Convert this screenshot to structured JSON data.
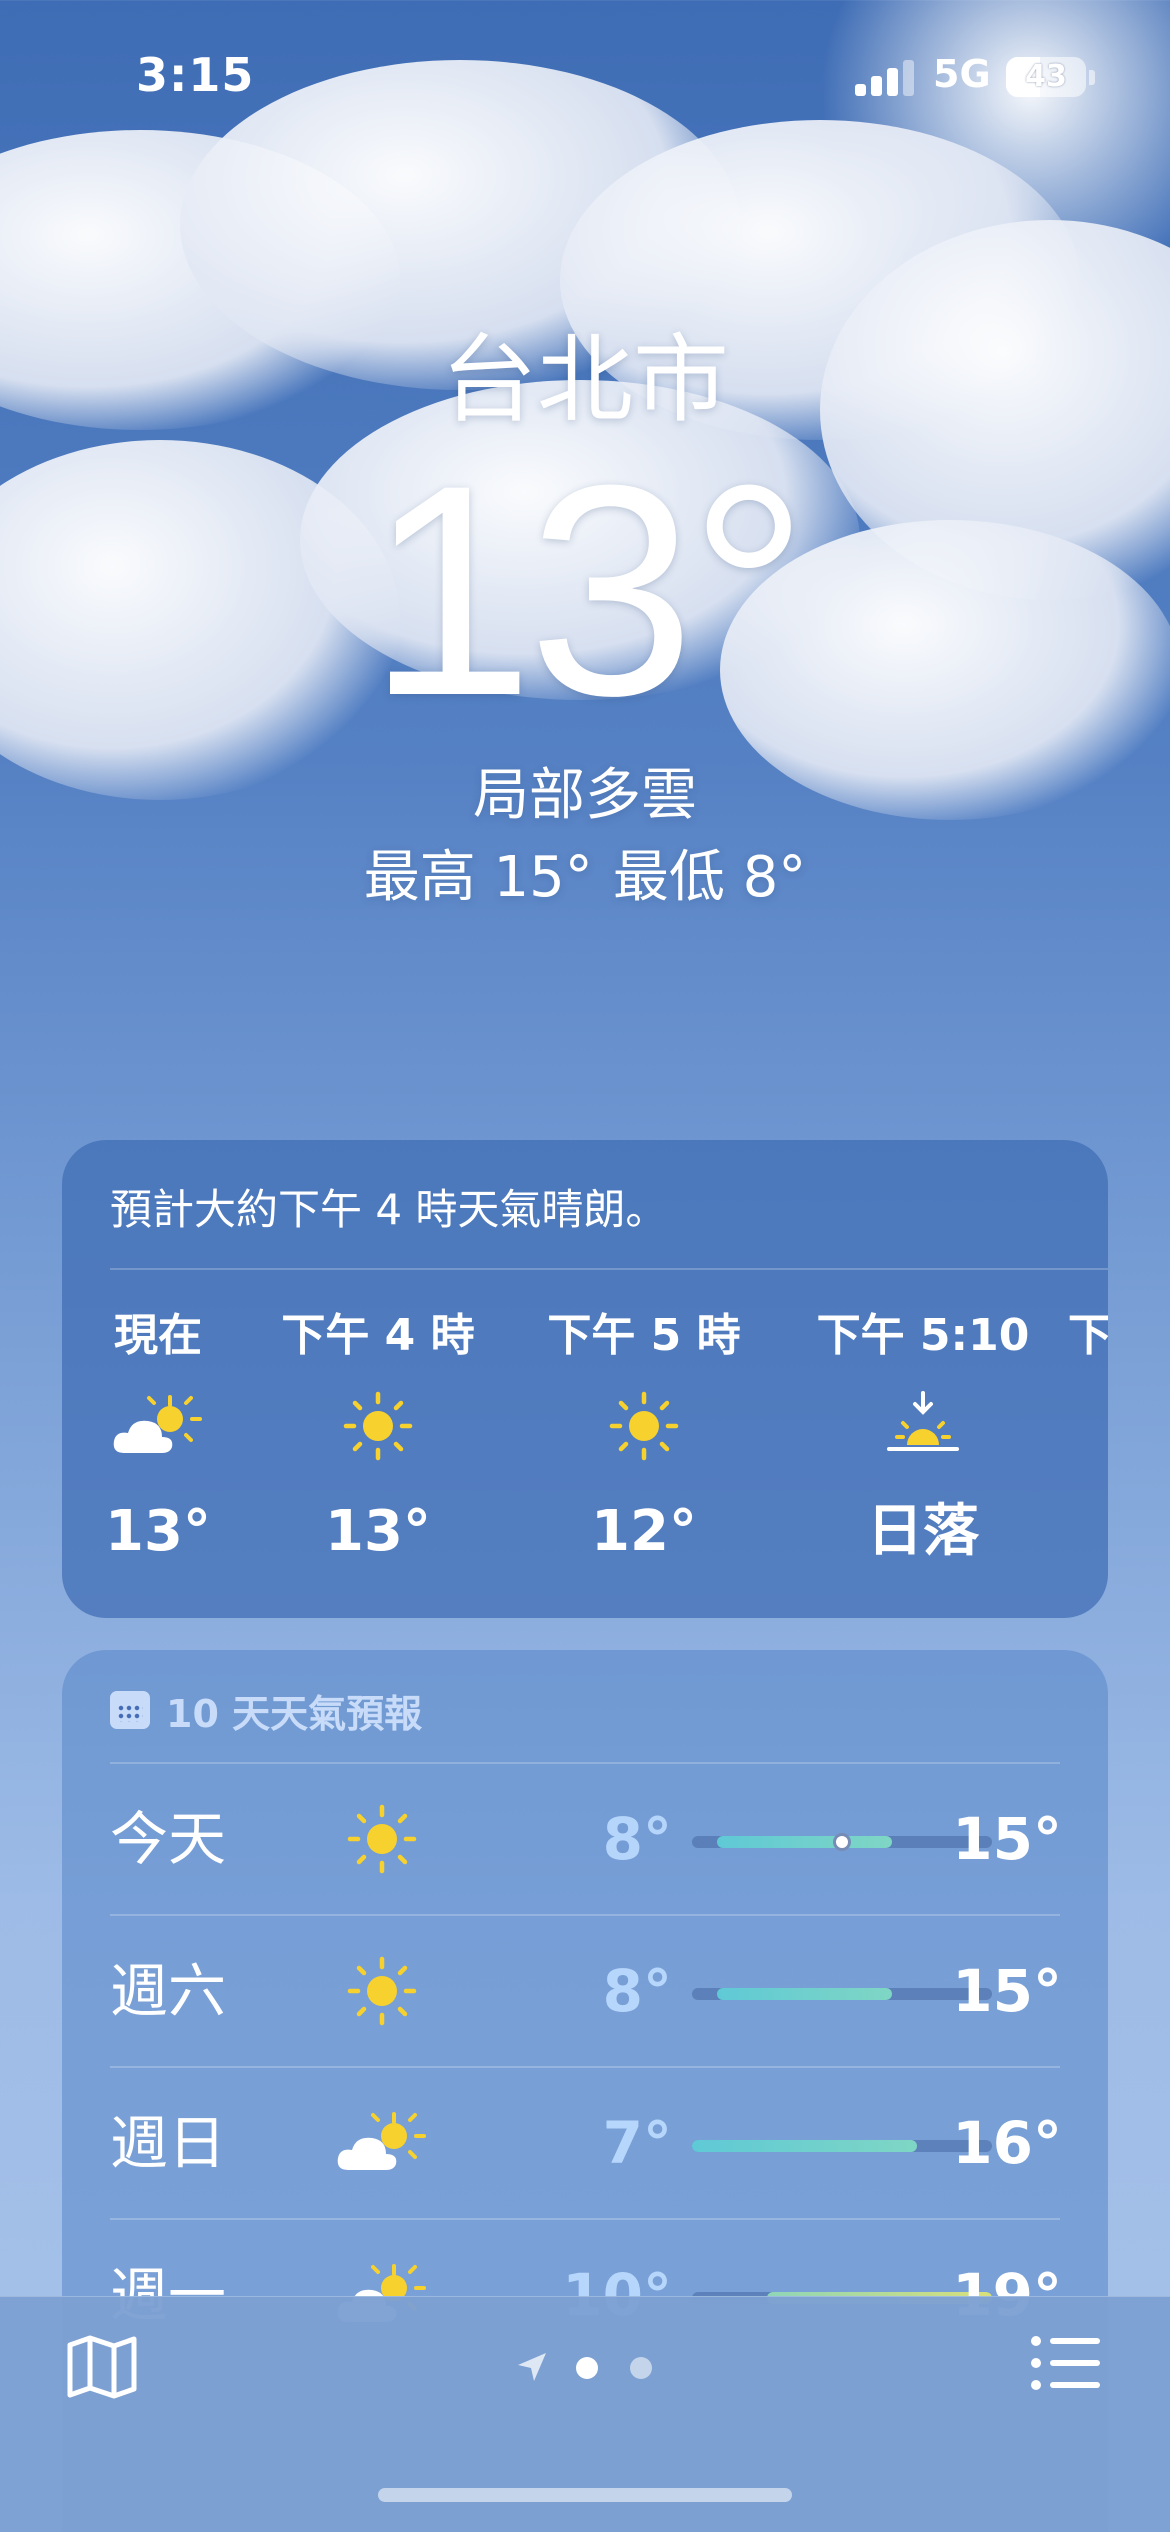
{
  "status_bar": {
    "time": "3:15",
    "network": "5G",
    "battery": "43",
    "battery_level": 0.43
  },
  "location": {
    "city": "台北市",
    "temperature": "13°",
    "condition": "局部多雲",
    "high": "最高 15°",
    "low": "最低 8°"
  },
  "hourly": {
    "summary": "預計大約下午 4 時天氣晴朗。",
    "items": [
      {
        "label": "現在",
        "icon": "partly-sunny-icon",
        "value": "13°"
      },
      {
        "label": "下午 4 時",
        "icon": "sun-icon",
        "value": "13°"
      },
      {
        "label": "下午 5 時",
        "icon": "sun-icon",
        "value": "12°"
      },
      {
        "label": "下午 5:10",
        "icon": "sunset-icon",
        "value": "日落"
      },
      {
        "label": "下",
        "icon": "",
        "value": ""
      }
    ]
  },
  "daily": {
    "header": "10 天天氣預報",
    "range": [
      7,
      19
    ],
    "rows": [
      {
        "day": "今天",
        "icon": "sun-icon",
        "low": "8°",
        "high": "15°",
        "low_val": 8,
        "high_val": 15,
        "current_val": 13
      },
      {
        "day": "週六",
        "icon": "sun-icon",
        "low": "8°",
        "high": "15°",
        "low_val": 8,
        "high_val": 15
      },
      {
        "day": "週日",
        "icon": "partly-sunny-icon",
        "low": "7°",
        "high": "16°",
        "low_val": 7,
        "high_val": 16
      },
      {
        "day": "週一",
        "icon": "partly-sunny-icon",
        "low": "10°",
        "high": "19°",
        "low_val": 10,
        "high_val": 19
      }
    ]
  },
  "tabbar": {
    "map_icon": "map-icon",
    "location_icon": "location-arrow-icon",
    "list_icon": "list-icon",
    "page_index": 1,
    "page_count": 2
  },
  "colors": {
    "sun": "#f7d12e",
    "bar_start": "#5fc9d6",
    "bar_end": "#7fd6c4",
    "low_temp": "#bedcff"
  }
}
